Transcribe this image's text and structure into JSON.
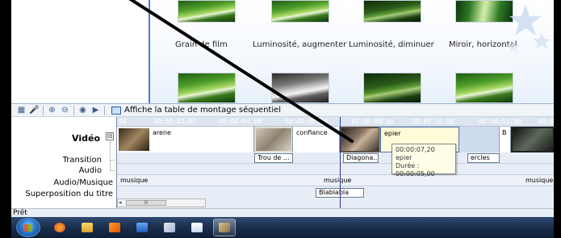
{
  "effects": {
    "items": [
      {
        "label": "Grain de film"
      },
      {
        "label": "Luminosité, augmenter"
      },
      {
        "label": "Luminosité, diminuer"
      },
      {
        "label": "Miroir, horizontal"
      }
    ]
  },
  "toolbar": {
    "storyboard_label": "Affiche la table de montage séquentiel"
  },
  "timeline": {
    "ruler_ticks": [
      "00:00:02,00",
      "00:00:04,00",
      "00:00:06,00",
      "00:00:08,00",
      "00:00:10,00",
      "00:00:12,00",
      "00:0"
    ],
    "ruler_start": "00",
    "track_labels": {
      "video": "Vidéo",
      "video_toggle": "⊟",
      "transition": "Transition",
      "audio": "Audio",
      "audio_music": "Audio/Musique",
      "title_overlay": "Superposition du titre"
    },
    "clips": [
      {
        "name": "arene"
      },
      {
        "name": "confiance"
      },
      {
        "name": "epier"
      },
      {
        "name": "B"
      }
    ],
    "transitions": [
      {
        "label": "Trou de ..."
      },
      {
        "label": "Diagona..."
      },
      {
        "label": "ercles"
      }
    ],
    "music": [
      "musique",
      "musique",
      "musique"
    ],
    "title_clip": "Blablabla",
    "scroll_thumb": "III"
  },
  "tooltip": {
    "time": "00:00:07,20",
    "clip": "epier",
    "duration": "Durée : 00:00:05,00"
  },
  "status": {
    "text": "Prêt"
  },
  "colors": {
    "accent": "#4b7fc4",
    "taskbar": "#1a2e4c",
    "selected_clip": "#fffbd8"
  }
}
